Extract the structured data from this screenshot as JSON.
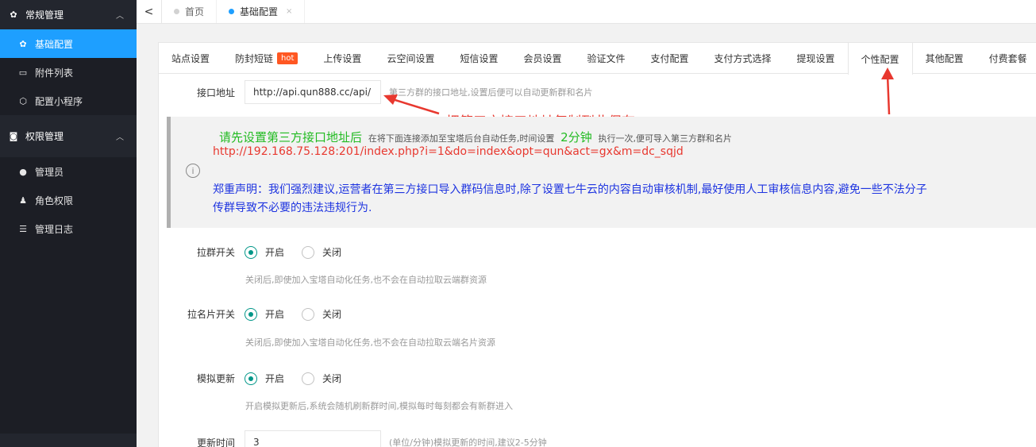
{
  "sidebar": {
    "groups": [
      {
        "label": "常规管理",
        "icon": "gear-icon",
        "items": [
          {
            "label": "基础配置",
            "icon": "gear-icon",
            "active": true
          },
          {
            "label": "附件列表",
            "icon": "folder-icon"
          },
          {
            "label": "配置小程序",
            "icon": "cube-icon"
          }
        ]
      },
      {
        "label": "权限管理",
        "icon": "cat-icon",
        "items": [
          {
            "label": "管理员",
            "icon": "user-circle-icon"
          },
          {
            "label": "角色权限",
            "icon": "person-icon"
          },
          {
            "label": "管理日志",
            "icon": "list-icon"
          }
        ]
      }
    ]
  },
  "topbar": {
    "back": "<",
    "tabs": [
      {
        "label": "首页",
        "active": false
      },
      {
        "label": "基础配置",
        "active": true,
        "close": "×"
      }
    ]
  },
  "tabs": [
    "站点设置",
    "防封短链",
    "上传设置",
    "云空间设置",
    "短信设置",
    "会员设置",
    "验证文件",
    "支付配置",
    "支付方式选择",
    "提现设置",
    "个性配置",
    "其他配置",
    "付费套餐"
  ],
  "hot_badge": "hot",
  "api": {
    "label": "接口地址",
    "value": "http://api.qun888.cc/api/",
    "help": "第三方群的接口地址,设置后便可以自动更新群和名片",
    "annotation": "把第三方接口地址复制到此保存"
  },
  "alert": {
    "lead": "请先设置第三方接口地址后",
    "mid": "在将下面连接添加至宝塔后台自动任务,时间设置",
    "interval": "2分钟",
    "tail": "执行一次,便可导入第三方群和名片",
    "url": "http://192.168.75.128:201/index.php?i=1&do=index&opt=qun&act=gx&m=dc_sqjd",
    "statement": "郑重声明：我们强烈建议,运营者在第三方接口导入群码信息时,除了设置七牛云的内容自动审核机制,最好使用人工审核信息内容,避免一些不法分子",
    "statement2": "传群导致不必要的违法违规行为.",
    "info": "i"
  },
  "fields": [
    {
      "label": "拉群开关",
      "on": "开启",
      "off": "关闭",
      "help": "关闭后,即使加入宝塔自动化任务,也不会在自动拉取云端群资源"
    },
    {
      "label": "拉名片开关",
      "on": "开启",
      "off": "关闭",
      "help": "关闭后,即使加入宝塔自动化任务,也不会在自动拉取云端名片资源"
    },
    {
      "label": "模拟更新",
      "on": "开启",
      "off": "关闭",
      "help": "开启模拟更新后,系统会随机刷新群时间,模拟每时每刻都会有新群进入"
    }
  ],
  "update_time": {
    "label": "更新时间",
    "value": "3",
    "help": "(单位/分钟)模拟更新的时间,建议2-5分钟"
  },
  "colors": {
    "sidebar_bg": "#23262e",
    "active_blue": "#1e9fff",
    "radio_green": "#009688",
    "annotation_red": "#e8382f",
    "alert_green": "#22bb22",
    "alert_red": "#e8382f",
    "alert_blue": "#1e34e0"
  }
}
